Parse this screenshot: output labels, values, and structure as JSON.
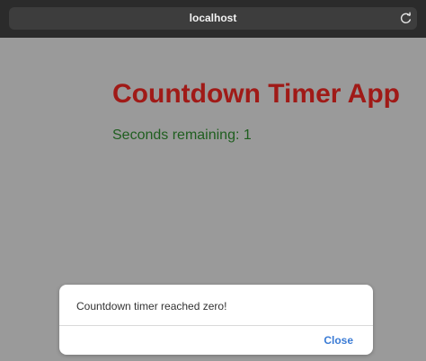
{
  "browser": {
    "url": "localhost",
    "reload_icon": "reload-icon"
  },
  "page": {
    "title": "Countdown Timer App",
    "seconds_label": "Seconds remaining: 1"
  },
  "alert": {
    "message": "Countdown timer reached zero!",
    "close_label": "Close"
  },
  "colors": {
    "title": "#a01a17",
    "seconds": "#1f5e1f",
    "overlay": "#9a9a9a",
    "button": "#3a7bd5"
  }
}
